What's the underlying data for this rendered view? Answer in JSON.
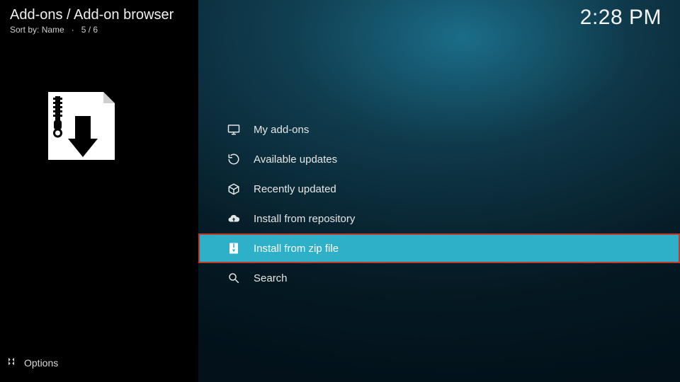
{
  "header": {
    "breadcrumb": "Add-ons / Add-on browser",
    "sort_prefix": "Sort by:",
    "sort_value": "Name",
    "position": "5 / 6"
  },
  "clock": "2:28 PM",
  "menu": {
    "items": [
      {
        "label": "My add-ons",
        "icon": "monitor-icon",
        "selected": false
      },
      {
        "label": "Available updates",
        "icon": "refresh-icon",
        "selected": false
      },
      {
        "label": "Recently updated",
        "icon": "box-icon",
        "selected": false
      },
      {
        "label": "Install from repository",
        "icon": "cloud-icon",
        "selected": false
      },
      {
        "label": "Install from zip file",
        "icon": "zip-icon",
        "selected": true
      },
      {
        "label": "Search",
        "icon": "search-icon",
        "selected": false
      }
    ]
  },
  "footer": {
    "options_label": "Options"
  },
  "colors": {
    "accent": "#2fb0c9",
    "highlight_border": "#c0392b",
    "text": "#e0e0e0",
    "bg_sidebar": "#000000"
  }
}
